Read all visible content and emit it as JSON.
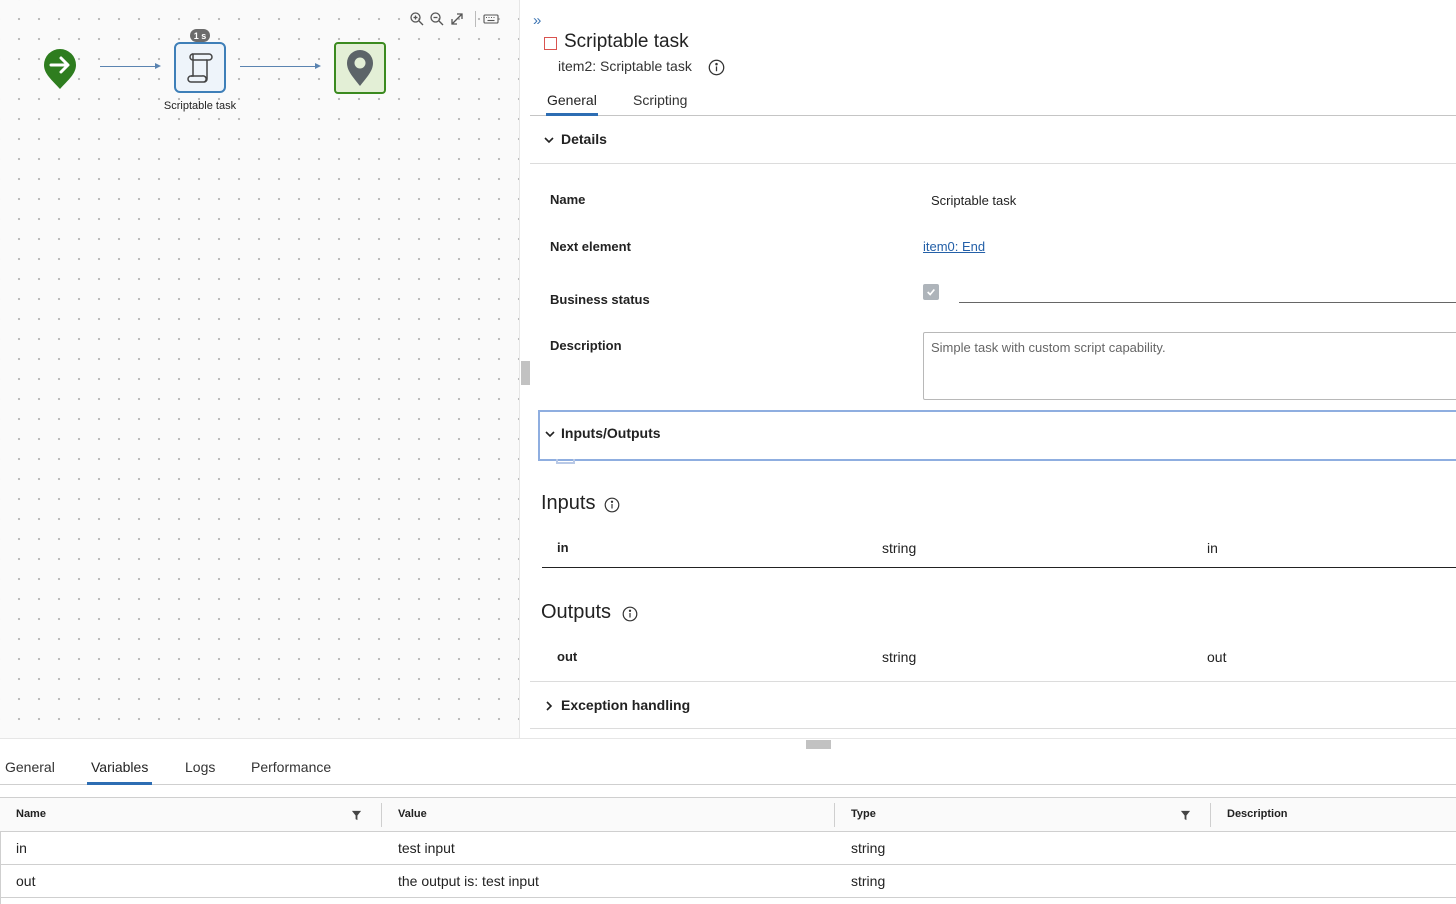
{
  "canvas": {
    "tools": [
      {
        "icon": "zoom-in-icon"
      },
      {
        "icon": "zoom-out-icon"
      },
      {
        "icon": "fit-screen-icon"
      },
      {
        "icon": "keyboard-icon"
      }
    ],
    "task_node": {
      "label": "Scriptable task",
      "badge": "1 s"
    },
    "colors": {
      "start": "#2e7d1f",
      "task_border": "#3e7fb8",
      "end_border": "#3b8a1f",
      "flow": "#5b84b1"
    }
  },
  "props": {
    "title": "Scriptable task",
    "subtitle": "item2: Scriptable task",
    "tabs": [
      "General",
      "Scripting"
    ],
    "active_tab": "General",
    "details": {
      "header": "Details",
      "name_label": "Name",
      "name_value": "Scriptable task",
      "next_label": "Next element",
      "next_value": "item0: End",
      "status_label": "Business status",
      "description_label": "Description",
      "description_value": "Simple task with custom script capability."
    },
    "io": {
      "header": "Inputs/Outputs",
      "inputs_heading": "Inputs",
      "inputs": [
        {
          "name": "in",
          "type": "string",
          "binding": "in"
        }
      ],
      "outputs_heading": "Outputs",
      "outputs": [
        {
          "name": "out",
          "type": "string",
          "binding": "out"
        }
      ]
    },
    "exception_header": "Exception handling"
  },
  "bottom": {
    "tabs": [
      "General",
      "Variables",
      "Logs",
      "Performance"
    ],
    "active_tab": "Variables",
    "columns": [
      "Name",
      "Value",
      "Type",
      "Description"
    ],
    "rows": [
      {
        "name": "in",
        "value": "test input",
        "type": "string",
        "description": ""
      },
      {
        "name": "out",
        "value": "the output is: test input",
        "type": "string",
        "description": ""
      }
    ]
  }
}
